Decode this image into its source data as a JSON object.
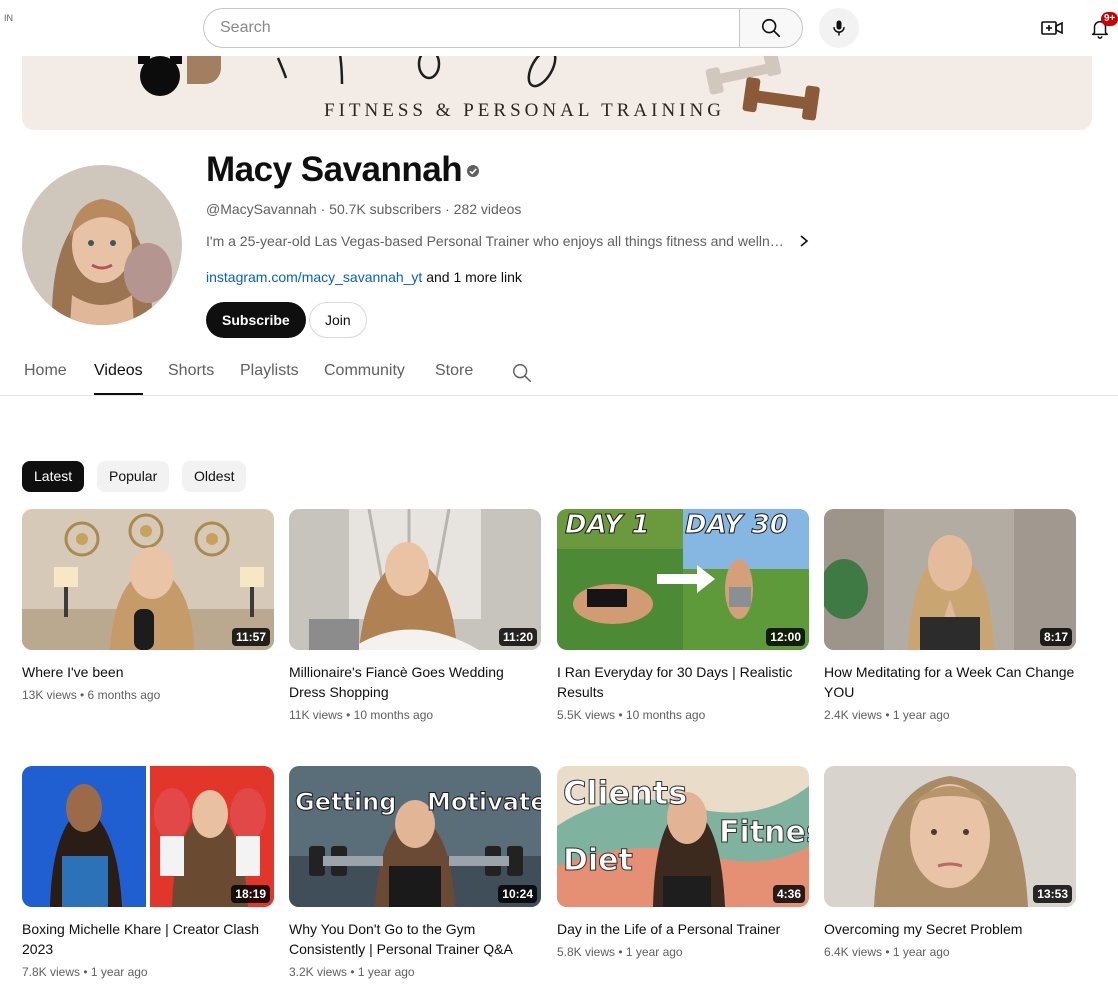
{
  "masthead": {
    "country_code": "IN",
    "search_placeholder": "Search",
    "notification_count": "9+"
  },
  "banner": {
    "title": "FITNESS & PERSONAL TRAINING"
  },
  "channel": {
    "name": "Macy Savannah",
    "handle": "@MacySavannah",
    "subscribers": "50.7K subscribers",
    "video_count": "282 videos",
    "meta_line": "@MacySavannah · 50.7K subscribers · 282 videos",
    "description": "I'm a 25-year-old Las Vegas-based Personal Trainer who enjoys all things fitness and welln…",
    "link_main": "instagram.com/macy_savannah_yt",
    "link_more": " and 1 more link",
    "subscribe_label": "Subscribe",
    "join_label": "Join"
  },
  "tabs": [
    {
      "label": "Home"
    },
    {
      "label": "Videos"
    },
    {
      "label": "Shorts"
    },
    {
      "label": "Playlists"
    },
    {
      "label": "Community"
    },
    {
      "label": "Store"
    }
  ],
  "active_tab": "Videos",
  "filters": [
    {
      "label": "Latest"
    },
    {
      "label": "Popular"
    },
    {
      "label": "Oldest"
    }
  ],
  "videos": [
    {
      "title": "Where I've been",
      "duration": "11:57",
      "views": "13K views",
      "age": "6 months ago",
      "meta": "13K views • 6 months ago"
    },
    {
      "title": "Millionaire's Fiancè Goes Wedding Dress Shopping",
      "duration": "11:20",
      "views": "11K views",
      "age": "10 months ago",
      "meta": "11K views • 10 months ago"
    },
    {
      "title": "I Ran Everyday for 30 Days | Realistic Results",
      "duration": "12:00",
      "views": "5.5K views",
      "age": "10 months ago",
      "meta": "5.5K views • 10 months ago",
      "thumb_text": [
        "DAY 1",
        "DAY 30"
      ]
    },
    {
      "title": "How Meditating for a Week Can Change YOU",
      "duration": "8:17",
      "views": "2.4K views",
      "age": "1 year ago",
      "meta": "2.4K views • 1 year ago"
    },
    {
      "title": "Boxing Michelle Khare | Creator Clash 2023",
      "duration": "18:19",
      "views": "7.8K views",
      "age": "1 year ago",
      "meta": "7.8K views • 1 year ago"
    },
    {
      "title": "Why You Don't Go to the Gym Consistently | Personal Trainer Q&A",
      "duration": "10:24",
      "views": "3.2K views",
      "age": "1 year ago",
      "meta": "3.2K views • 1 year ago",
      "thumb_text": [
        "Getting",
        "Motivated"
      ]
    },
    {
      "title": "Day in the Life of a Personal Trainer",
      "duration": "4:36",
      "views": "5.8K views",
      "age": "1 year ago",
      "meta": "5.8K views • 1 year ago",
      "thumb_text": [
        "Clients",
        "Fitness",
        "Diet"
      ]
    },
    {
      "title": "Overcoming my Secret Problem",
      "duration": "13:53",
      "views": "6.4K views",
      "age": "1 year ago",
      "meta": "6.4K views • 1 year ago"
    }
  ],
  "icons": {
    "search": "search-icon",
    "mic": "mic-icon",
    "create": "create-video-icon",
    "notifications": "bell-icon",
    "verified": "verified-badge-icon",
    "chevron": "chevron-right-icon"
  },
  "colors": {
    "link": "#065fd4",
    "subscribe_bg": "#0f0f0f",
    "badge": "#cc0000",
    "banner_bg": "#f3ece6"
  }
}
